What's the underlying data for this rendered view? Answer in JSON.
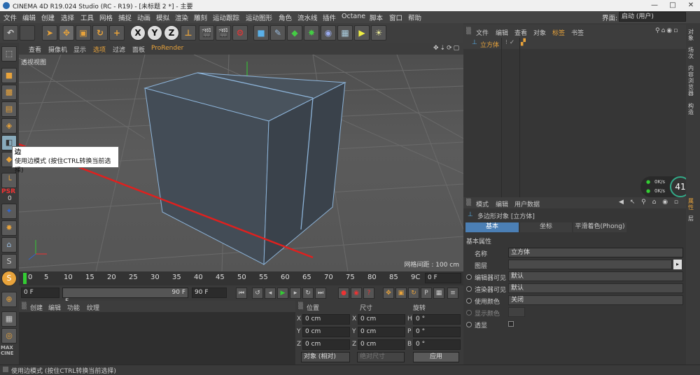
{
  "titlebar": {
    "title": "CINEMA 4D R19.024 Studio (RC - R19) - [未标题 2 *] - 主要",
    "min": "—",
    "max": "□",
    "close": "✕"
  },
  "menu": [
    "文件",
    "编辑",
    "创建",
    "选择",
    "工具",
    "网格",
    "捕捉",
    "动画",
    "模拟",
    "渲染",
    "雕刻",
    "运动跟踪",
    "运动图形",
    "角色",
    "流水线",
    "插件",
    "Octane",
    "脚本",
    "窗口",
    "帮助"
  ],
  "layout": {
    "label": "界面:",
    "value": "启动 (用户)"
  },
  "toolbar": {
    "x": "X",
    "y": "Y",
    "z": "Z"
  },
  "viewport": {
    "menu": [
      "查看",
      "摄像机",
      "显示",
      "选项",
      "过滤",
      "面板"
    ],
    "prorender": "ProRender",
    "label": "透视视图",
    "grid_info": "网格间距 : 100 cm"
  },
  "tooltip": {
    "title": "边",
    "body": "使用边模式 (按住CTRL转换当前选择)"
  },
  "psr": {
    "label": "PSR",
    "value": "0"
  },
  "timeline": {
    "ticks": [
      "0",
      "5",
      "10",
      "15",
      "20",
      "25",
      "30",
      "35",
      "40",
      "45",
      "50",
      "55",
      "60",
      "65",
      "70",
      "75",
      "80",
      "85",
      "9C"
    ],
    "right_frame": "0 F"
  },
  "time": {
    "start": "0 F",
    "range_start": "0 F",
    "range_end": "90 F",
    "end": "90 F"
  },
  "material": {
    "menu": [
      "创建",
      "编辑",
      "功能",
      "纹理"
    ]
  },
  "coords": {
    "headers": [
      "位置",
      "尺寸",
      "旋转"
    ],
    "rows": [
      {
        "a": "X",
        "pv": "0 cm",
        "sa": "X",
        "sv": "0 cm",
        "ra": "H",
        "rv": "0 °"
      },
      {
        "a": "Y",
        "pv": "0 cm",
        "sa": "Y",
        "sv": "0 cm",
        "ra": "P",
        "rv": "0 °"
      },
      {
        "a": "Z",
        "pv": "0 cm",
        "sa": "Z",
        "sv": "0 cm",
        "ra": "B",
        "rv": "0 °"
      }
    ],
    "mode": "对象 (相对)",
    "size_mode": "绝对尺寸",
    "apply": "应用"
  },
  "objects": {
    "menu": [
      "文件",
      "编辑",
      "查看",
      "对象",
      "标签",
      "书签"
    ],
    "item": "立方体"
  },
  "hud": {
    "up": "0K/s",
    "down": "0K/s",
    "percent": "41"
  },
  "attributes": {
    "menu": [
      "模式",
      "编辑",
      "用户数据"
    ],
    "title": "多边形对象 [立方体]",
    "tabs": [
      "基本",
      "坐标",
      "平滑着色(Phong)"
    ],
    "section": "基本属性",
    "fields": [
      {
        "label": "名称",
        "value": "立方体"
      },
      {
        "label": "图层",
        "value": ""
      },
      {
        "label": "编辑器可见",
        "value": "默认"
      },
      {
        "label": "渲染器可见",
        "value": "默认"
      },
      {
        "label": "使用颜色",
        "value": "关闭"
      },
      {
        "label": "显示颜色",
        "value": ""
      },
      {
        "label": "透显",
        "value": ""
      }
    ]
  },
  "sidetabs": [
    "对象",
    "场次",
    "内容浏览器",
    "构造",
    "属性",
    "层"
  ],
  "status": "使用边模式 (按住CTRL转换当前选择)",
  "colors": {
    "accent": "#e8a33b",
    "viewport_bg": "#555555",
    "panel": "#363636",
    "arrow": "#e0201e",
    "cube_face": "#3f4a55",
    "cube_edge": "#8db4d9"
  }
}
